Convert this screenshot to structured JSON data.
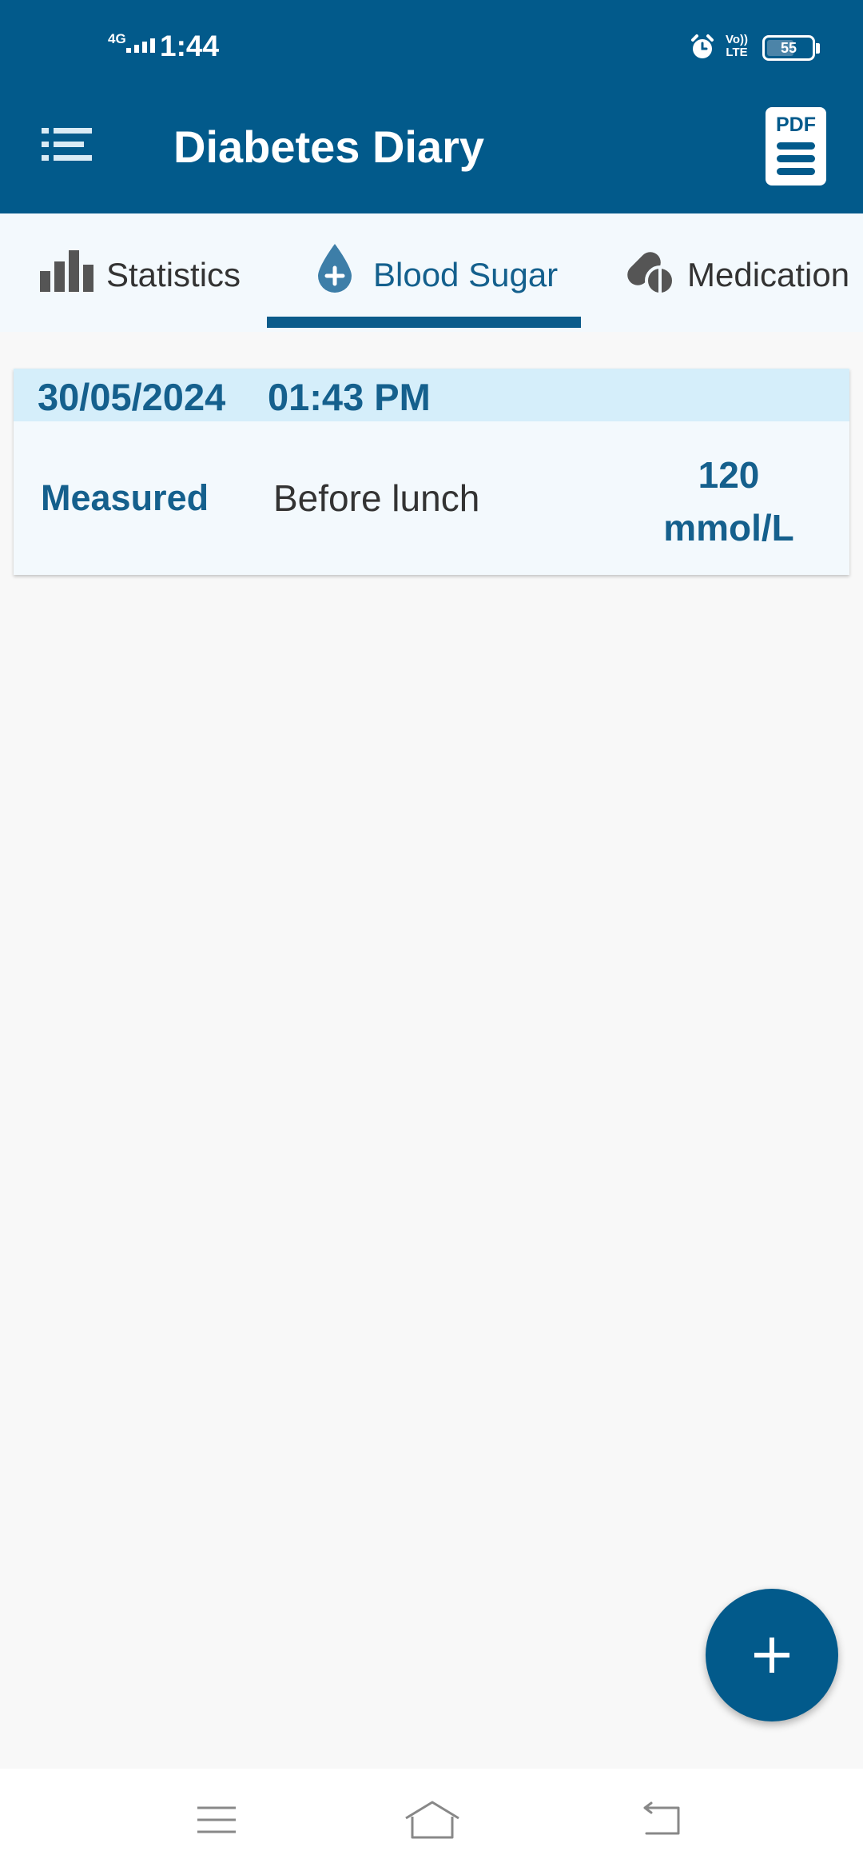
{
  "status_bar": {
    "network": "4G",
    "time": "1:44",
    "volte_top": "Vo))",
    "volte_bottom": "LTE",
    "battery_level": "55",
    "icons": [
      "signal-icon",
      "alarm-icon",
      "volte-icon",
      "battery-icon"
    ]
  },
  "app_bar": {
    "title": "Diabetes Diary",
    "menu_icon": "menu-list-icon",
    "pdf_label": "PDF"
  },
  "tabs": [
    {
      "label": "Statistics",
      "icon": "bar-chart-icon",
      "selected": false
    },
    {
      "label": "Blood Sugar",
      "icon": "blood-drop-plus-icon",
      "selected": true
    },
    {
      "label": "Medication",
      "icon": "pills-icon",
      "selected": false
    }
  ],
  "entries": [
    {
      "date": "30/05/2024",
      "time": "01:43 PM",
      "measured_label": "Measured",
      "meal": "Before lunch",
      "value": "120",
      "unit": "mmol/L"
    }
  ],
  "fab": {
    "icon": "plus-icon"
  },
  "nav_bar": {
    "icons": [
      "recents-icon",
      "home-icon",
      "back-icon"
    ]
  },
  "colors": {
    "primary": "#025a8b",
    "tab_background": "#f3f9fd",
    "card_header": "#d5eefa",
    "background": "#f8f8f8"
  }
}
